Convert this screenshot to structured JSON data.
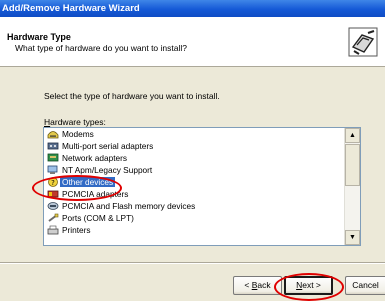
{
  "window": {
    "title": "Add/Remove Hardware Wizard"
  },
  "header": {
    "title": "Hardware Type",
    "subtitle": "What type of hardware do you want to install?",
    "icon": "hardware-wizard-icon"
  },
  "body": {
    "instruction": "Select the type of hardware you want to install.",
    "list_label_accel": "H",
    "list_label_rest": "ardware types:"
  },
  "hardware_types": [
    {
      "label": "Modems",
      "icon": "modem-icon"
    },
    {
      "label": "Multi-port serial adapters",
      "icon": "serial-adapter-icon"
    },
    {
      "label": "Network adapters",
      "icon": "network-adapter-icon"
    },
    {
      "label": "NT Apm/Legacy Support",
      "icon": "legacy-support-icon"
    },
    {
      "label": "Other devices",
      "icon": "unknown-device-icon",
      "selected": true
    },
    {
      "label": "PCMCIA adapters",
      "icon": "pcmcia-adapter-icon"
    },
    {
      "label": "PCMCIA and Flash memory devices",
      "icon": "flash-memory-icon"
    },
    {
      "label": "Ports (COM & LPT)",
      "icon": "ports-icon"
    },
    {
      "label": "Printers",
      "icon": "printer-icon"
    }
  ],
  "buttons": {
    "back_prefix": "< ",
    "back_accel": "B",
    "back_rest": "ack",
    "next_accel": "N",
    "next_rest": "ext >",
    "cancel": "Cancel"
  },
  "colors": {
    "selection": "#316ac5",
    "titlebar": "#1559d6",
    "annotation": "#e00000"
  }
}
